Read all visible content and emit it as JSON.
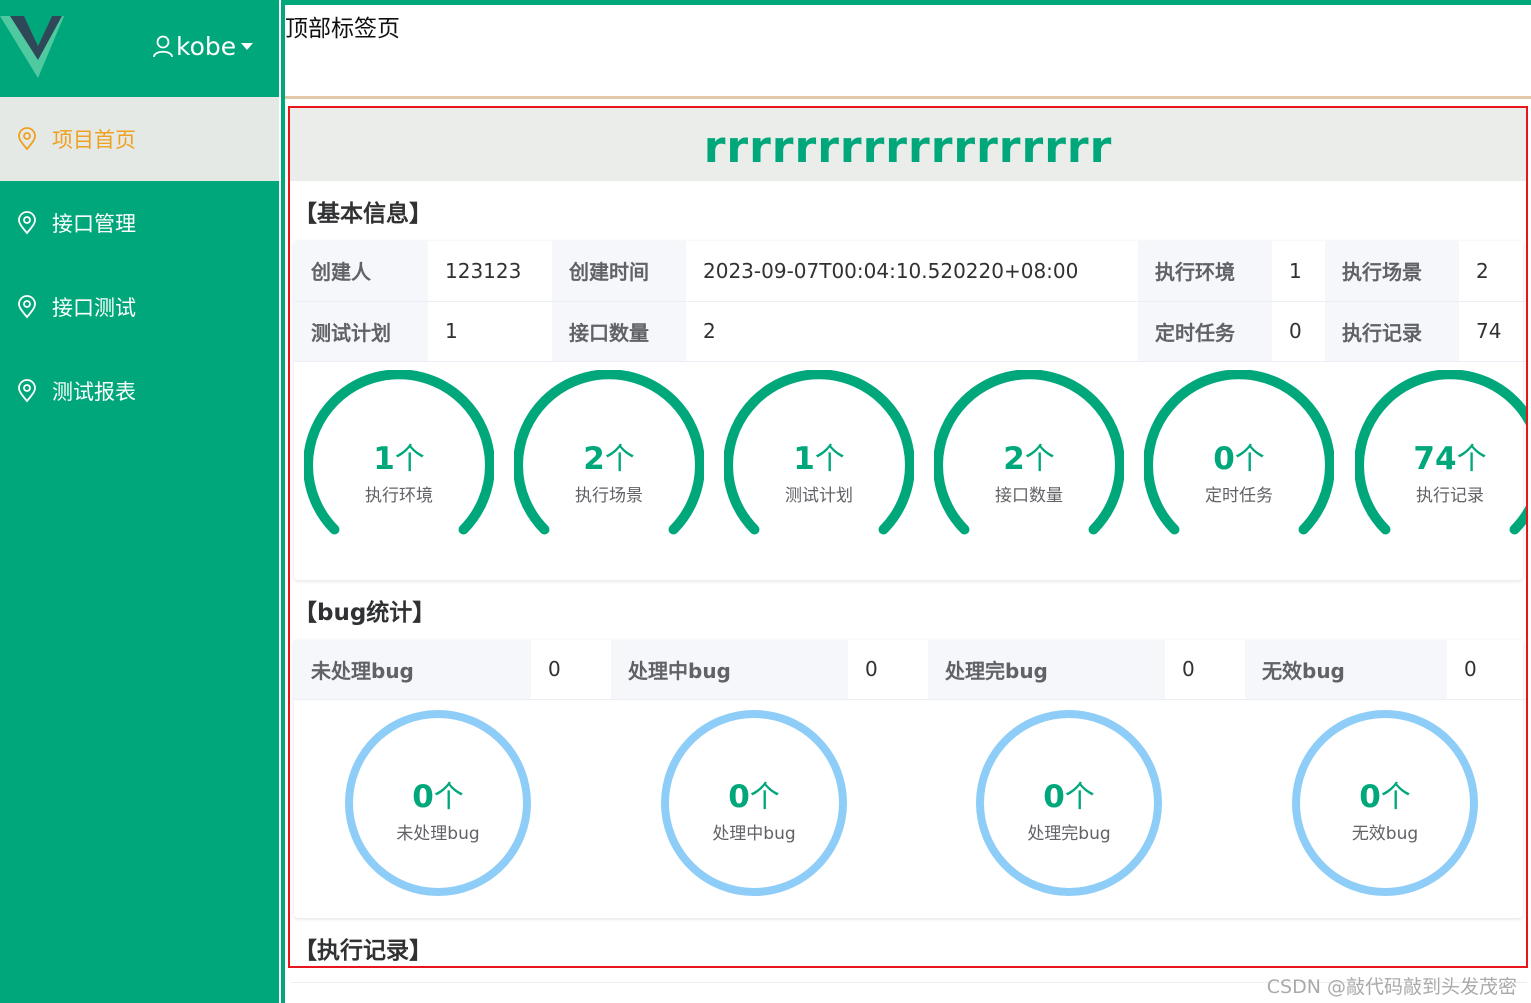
{
  "user": {
    "name": "kobe"
  },
  "sidebar": {
    "items": [
      {
        "label": "项目首页",
        "active": true
      },
      {
        "label": "接口管理",
        "active": false
      },
      {
        "label": "接口测试",
        "active": false
      },
      {
        "label": "测试报表",
        "active": false
      }
    ]
  },
  "tabs": {
    "title": "顶部标签页"
  },
  "project": {
    "name": "rrrrrrrrrrrrrrrrrr"
  },
  "basic_info": {
    "title": "【基本信息】",
    "rows": [
      [
        {
          "label": "创建人",
          "value": "123123"
        },
        {
          "label": "创建时间",
          "value": "2023-09-07T00:04:10.520220+08:00"
        },
        {
          "label": "执行环境",
          "value": "1"
        },
        {
          "label": "执行场景",
          "value": "2"
        }
      ],
      [
        {
          "label": "测试计划",
          "value": "1"
        },
        {
          "label": "接口数量",
          "value": "2"
        },
        {
          "label": "定时任务",
          "value": "0"
        },
        {
          "label": "执行记录",
          "value": "74"
        }
      ]
    ],
    "gauges": [
      {
        "value": "1",
        "unit": "个",
        "label": "执行环境"
      },
      {
        "value": "2",
        "unit": "个",
        "label": "执行场景"
      },
      {
        "value": "1",
        "unit": "个",
        "label": "测试计划"
      },
      {
        "value": "2",
        "unit": "个",
        "label": "接口数量"
      },
      {
        "value": "0",
        "unit": "个",
        "label": "定时任务"
      },
      {
        "value": "74",
        "unit": "个",
        "label": "执行记录"
      }
    ]
  },
  "bug_stats": {
    "title": "【bug统计】",
    "row": [
      {
        "label": "未处理bug",
        "value": "0"
      },
      {
        "label": "处理中bug",
        "value": "0"
      },
      {
        "label": "处理完bug",
        "value": "0"
      },
      {
        "label": "无效bug",
        "value": "0"
      }
    ],
    "gauges": [
      {
        "value": "0",
        "unit": "个",
        "label": "未处理bug"
      },
      {
        "value": "0",
        "unit": "个",
        "label": "处理中bug"
      },
      {
        "value": "0",
        "unit": "个",
        "label": "处理完bug"
      },
      {
        "value": "0",
        "unit": "个",
        "label": "无效bug"
      }
    ]
  },
  "exec_records": {
    "title": "【执行记录】"
  },
  "watermark": "CSDN @敲代码敲到头发茂密",
  "colors": {
    "brand": "#00a77a",
    "active_text": "#f0a020",
    "bug_ring": "#8ecdf7",
    "border_red": "#e8151b"
  }
}
